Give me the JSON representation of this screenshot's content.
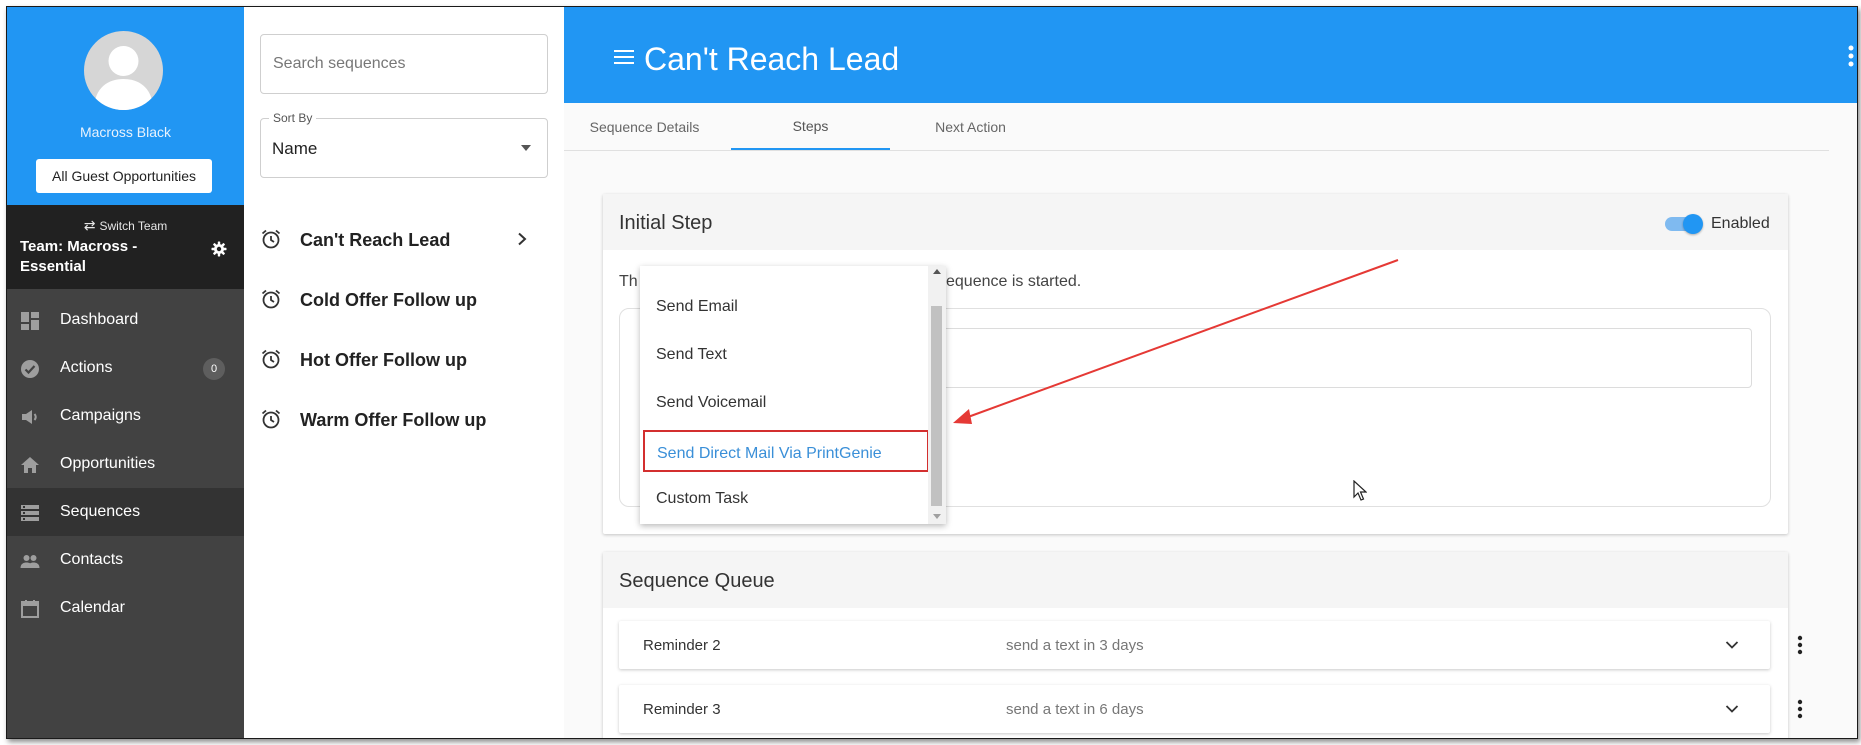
{
  "sidebar": {
    "user_name": "Macross Black",
    "guest_button": "All Guest Opportunities",
    "switch_team": "Switch Team",
    "team_name": "Team: Macross - Essential",
    "nav": [
      {
        "label": "Dashboard",
        "icon": "dashboard-icon"
      },
      {
        "label": "Actions",
        "icon": "check-circle-icon",
        "badge": "0"
      },
      {
        "label": "Campaigns",
        "icon": "megaphone-icon"
      },
      {
        "label": "Opportunities",
        "icon": "home-icon"
      },
      {
        "label": "Sequences",
        "icon": "storage-icon",
        "active": true
      },
      {
        "label": "Contacts",
        "icon": "people-icon"
      },
      {
        "label": "Calendar",
        "icon": "calendar-icon"
      }
    ]
  },
  "sequence_list": {
    "search_placeholder": "Search sequences",
    "sort_label": "Sort By",
    "sort_value": "Name",
    "items": [
      {
        "label": "Can't Reach Lead",
        "selected": true
      },
      {
        "label": "Cold Offer Follow up"
      },
      {
        "label": "Hot Offer Follow up"
      },
      {
        "label": "Warm Offer Follow up"
      }
    ]
  },
  "header": {
    "title": "Can't Reach Lead"
  },
  "tabs": [
    {
      "label": "Sequence Details"
    },
    {
      "label": "Steps",
      "active": true
    },
    {
      "label": "Next Action"
    }
  ],
  "initial_step": {
    "title": "Initial Step",
    "toggle_label": "Enabled",
    "toggle_on": true,
    "desc_start": "Th",
    "desc_end": "sequence is started."
  },
  "dropdown": {
    "options": [
      {
        "label": "Send Email"
      },
      {
        "label": "Send Text"
      },
      {
        "label": "Send Voicemail"
      },
      {
        "label": "Send Direct Mail Via PrintGenie",
        "highlighted": true
      },
      {
        "label": "Custom Task"
      }
    ]
  },
  "queue": {
    "title": "Sequence Queue",
    "rows": [
      {
        "name": "Reminder 2",
        "desc": "send a text in 3 days"
      },
      {
        "name": "Reminder 3",
        "desc": "send a text in 6 days"
      }
    ]
  },
  "colors": {
    "primary": "#2196f3",
    "sidebar_bg": "#424242",
    "sidebar_dark": "#212121",
    "annotation_red": "#d32f2f",
    "link_blue": "#3a8fd8"
  }
}
